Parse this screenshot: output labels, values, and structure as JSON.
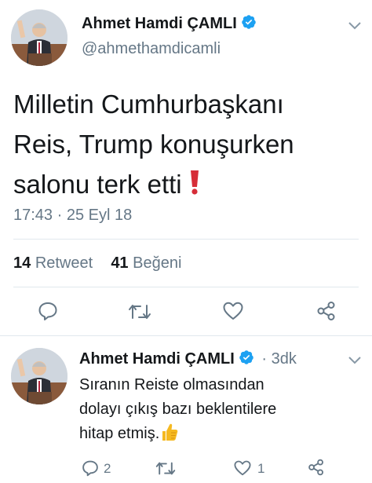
{
  "main_tweet": {
    "author_name": "Ahmet Hamdi ÇAMLI",
    "handle": "@ahmethamdicamli",
    "text_lines": [
      "Milletin Cumhurbaşkanı",
      "Reis, Trump konuşurken",
      "salonu terk etti"
    ],
    "emoji": "❗",
    "timestamp": "17:43 · 25 Eyl 18",
    "retweet_count": "14",
    "retweet_label": "Retweet",
    "like_count": "41",
    "like_label": "Beğeni"
  },
  "reply_tweet": {
    "author_name": "Ahmet Hamdi ÇAMLI",
    "separator": "·",
    "time_ago": "3dk",
    "text_lines": [
      "Sıranın Reiste olmasından",
      "dolayı çıkış bazı beklentilere",
      "hitap etmiş."
    ],
    "emoji": "👍",
    "reply_count": "2",
    "like_count": "1"
  },
  "icons": {
    "verified": "verified-badge-icon",
    "menu": "chevron-down-icon",
    "reply": "reply-icon",
    "retweet": "retweet-icon",
    "like": "heart-icon",
    "share": "share-icon"
  },
  "colors": {
    "text": "#14171a",
    "secondary": "#657786",
    "verified": "#1da1f2",
    "divider": "#e1e8ed",
    "emoji_red": "#d62d38",
    "emoji_thumb": "#f5b921"
  }
}
